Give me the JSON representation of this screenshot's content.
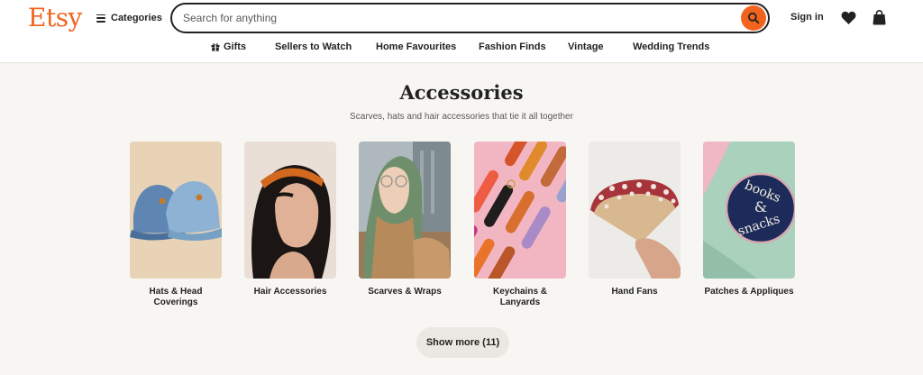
{
  "header": {
    "logo": "Etsy",
    "categories_label": "Categories",
    "search_placeholder": "Search for anything",
    "signin_label": "Sign in"
  },
  "nav": [
    {
      "label": "Gifts",
      "icon": "gift-icon"
    },
    {
      "label": "Sellers to Watch"
    },
    {
      "label": "Home Favourites"
    },
    {
      "label": "Fashion Finds"
    },
    {
      "label": "Vintage"
    },
    {
      "label": "Wedding Trends"
    }
  ],
  "section": {
    "title": "Accessories",
    "subtitle": "Scarves, hats and hair accessories that tie it all together"
  },
  "tiles": [
    {
      "label": "Hats & Head Coverings",
      "image": "denim-caps"
    },
    {
      "label": "Hair Accessories",
      "image": "orange-headband"
    },
    {
      "label": "Scarves & Wraps",
      "image": "green-headscarf"
    },
    {
      "label": "Keychains & Lanyards",
      "image": "leather-keychains"
    },
    {
      "label": "Hand Fans",
      "image": "floral-fan"
    },
    {
      "label": "Patches & Appliques",
      "image": "books-snacks-patch"
    }
  ],
  "patch_text": "books & snacks",
  "show_more_label": "Show more (11)",
  "colors": {
    "brand": "#f1641e",
    "background": "#f8f6f3"
  }
}
